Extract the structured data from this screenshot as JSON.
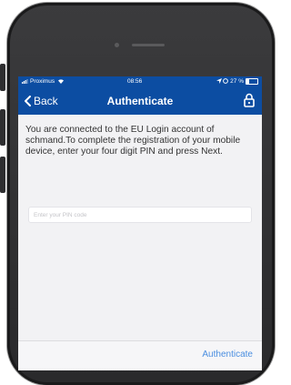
{
  "status_bar": {
    "carrier": "Proximus",
    "time": "08:56",
    "battery": "27 %"
  },
  "nav": {
    "back_label": "Back",
    "title": "Authenticate"
  },
  "content": {
    "message": "You are connected to the EU Login account of schmand.To complete the registration of your mobile device, enter your four digit PIN and press Next.",
    "pin_placeholder": "Enter your PIN code",
    "pin_value": ""
  },
  "footer": {
    "authenticate_label": "Authenticate"
  },
  "colors": {
    "brand_blue": "#0c4da2",
    "link_blue": "#4a8ee0",
    "background": "#f2f2f4"
  }
}
